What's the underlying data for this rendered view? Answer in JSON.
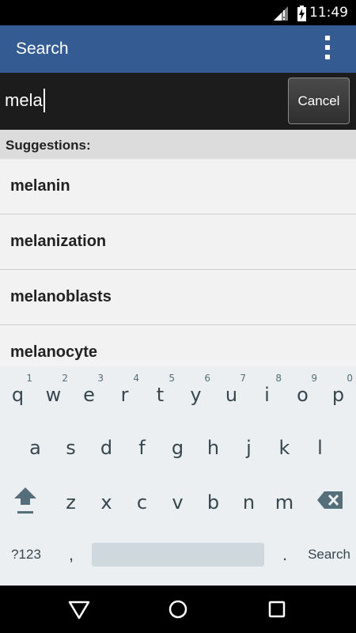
{
  "status_bar": {
    "time": "11:49",
    "icons": [
      "signal-icon",
      "battery-charging-icon"
    ]
  },
  "app_bar": {
    "title": "Search",
    "menu_icon": "overflow-menu-icon"
  },
  "search": {
    "query": "mela",
    "cancel_label": "Cancel"
  },
  "suggestions": {
    "header": "Suggestions:",
    "items": [
      "melanin",
      "melanization",
      "melanoblasts",
      "melanocyte"
    ]
  },
  "keyboard": {
    "row1": [
      {
        "key": "q",
        "hint": "1"
      },
      {
        "key": "w",
        "hint": "2"
      },
      {
        "key": "e",
        "hint": "3"
      },
      {
        "key": "r",
        "hint": "4"
      },
      {
        "key": "t",
        "hint": "5"
      },
      {
        "key": "y",
        "hint": "6"
      },
      {
        "key": "u",
        "hint": "7"
      },
      {
        "key": "i",
        "hint": "8"
      },
      {
        "key": "o",
        "hint": "9"
      },
      {
        "key": "p",
        "hint": "0"
      }
    ],
    "row2": [
      "a",
      "s",
      "d",
      "f",
      "g",
      "h",
      "j",
      "k",
      "l"
    ],
    "row3": [
      "z",
      "x",
      "c",
      "v",
      "b",
      "n",
      "m"
    ],
    "symbols_label": "?123",
    "comma": ",",
    "period": ".",
    "action_label": "Search",
    "shift_icon": "shift-icon",
    "backspace_icon": "backspace-icon"
  },
  "nav_bar": {
    "icons": [
      "back-icon",
      "home-icon",
      "recents-icon"
    ]
  }
}
